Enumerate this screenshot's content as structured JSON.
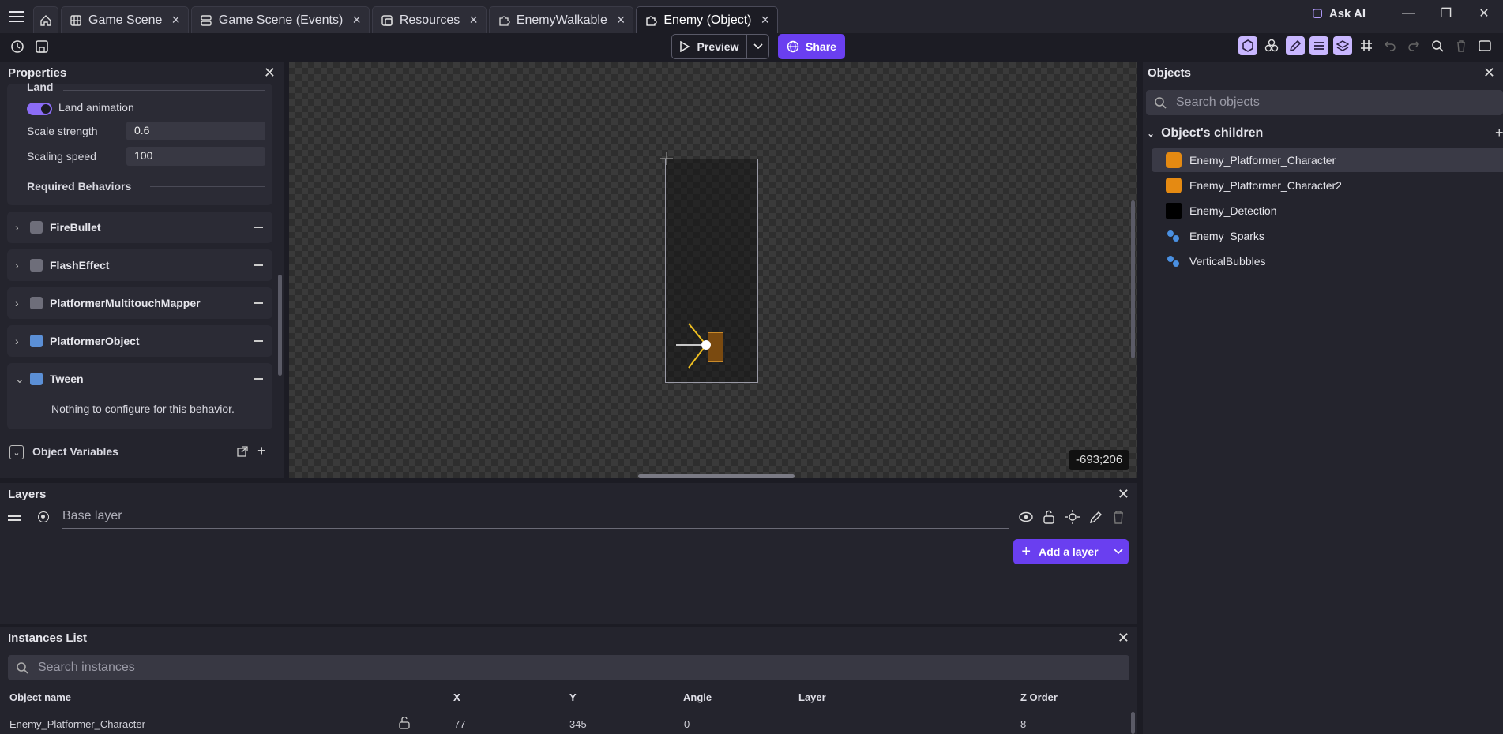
{
  "tabs": [
    {
      "label": "Game Scene",
      "icon": "scene-icon"
    },
    {
      "label": "Game Scene (Events)",
      "icon": "events-icon"
    },
    {
      "label": "Resources",
      "icon": "resources-icon"
    },
    {
      "label": "EnemyWalkable",
      "icon": "puzzle-icon"
    },
    {
      "label": "Enemy (Object)",
      "icon": "puzzle-icon",
      "active": true
    }
  ],
  "top_right": {
    "ask_ai": "Ask AI"
  },
  "toolbar": {
    "preview": "Preview",
    "share": "Share"
  },
  "properties": {
    "title": "Properties",
    "section_land": "Land",
    "land_animation": "Land animation",
    "land_animation_on": true,
    "scale_strength_label": "Scale strength",
    "scale_strength_value": "0.6",
    "scaling_speed_label": "Scaling speed",
    "scaling_speed_value": "100",
    "required_behaviors": "Required Behaviors",
    "behaviors": [
      "FireBullet",
      "FlashEffect",
      "PlatformerMultitouchMapper",
      "PlatformerObject",
      "Tween"
    ],
    "tween_note": "Nothing to configure for this behavior.",
    "object_variables": "Object Variables"
  },
  "canvas": {
    "coords": "-693;206"
  },
  "objects": {
    "title": "Objects",
    "search_placeholder": "Search objects",
    "section": "Object's children",
    "items": [
      {
        "name": "Enemy_Platformer_Character",
        "icon": "character-icon",
        "selected": true
      },
      {
        "name": "Enemy_Platformer_Character2",
        "icon": "character-icon"
      },
      {
        "name": "Enemy_Detection",
        "icon": "black-square-icon"
      },
      {
        "name": "Enemy_Sparks",
        "icon": "particles-icon"
      },
      {
        "name": "VerticalBubbles",
        "icon": "particles-icon"
      }
    ]
  },
  "layers": {
    "title": "Layers",
    "base_layer": "Base layer",
    "add_layer": "Add a layer"
  },
  "instances": {
    "title": "Instances List",
    "search_placeholder": "Search instances",
    "columns": [
      "Object name",
      "X",
      "Y",
      "Angle",
      "Layer",
      "Z Order"
    ],
    "rows": [
      [
        "Enemy_Platformer_Character",
        "77",
        "345",
        "0",
        "",
        "8"
      ]
    ]
  },
  "colors": {
    "accent": "#6a3ff0",
    "panel": "#24242d",
    "background": "#1c1c24"
  }
}
